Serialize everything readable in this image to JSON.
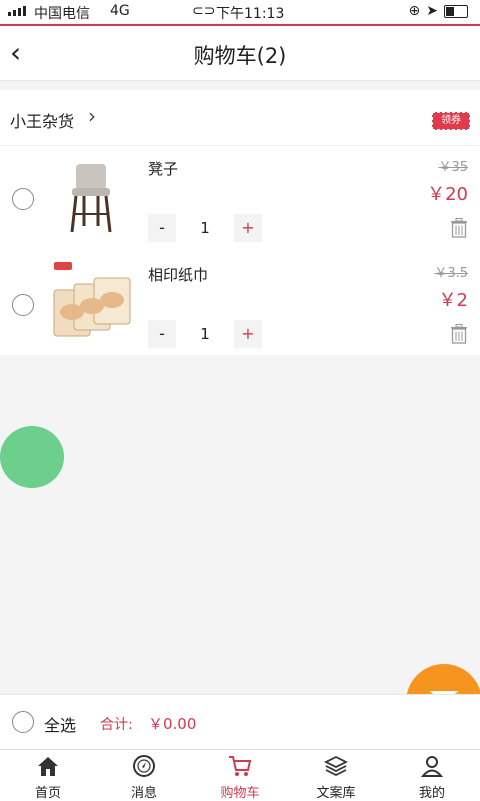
{
  "status_bar": {
    "carrier": "中国电信",
    "network": "4G",
    "time": "下午11:13"
  },
  "nav": {
    "title": "购物车(2)"
  },
  "shop": {
    "name": "小王杂货",
    "coupon_label": "领券"
  },
  "items": [
    {
      "name": "凳子",
      "original_price": "￥35",
      "price": "￥20",
      "quantity": "1",
      "minus": "-",
      "plus": "+"
    },
    {
      "name": "相印纸巾",
      "original_price": "￥3.5",
      "price": "￥2",
      "quantity": "1",
      "minus": "-",
      "plus": "+"
    }
  ],
  "footer": {
    "select_all": "全选",
    "total_label": "合计:",
    "total_value": "￥0.00"
  },
  "tabs": [
    {
      "label": "首页",
      "icon": "home-icon"
    },
    {
      "label": "消息",
      "icon": "compass-icon"
    },
    {
      "label": "购物车",
      "icon": "cart-icon",
      "active": true
    },
    {
      "label": "文案库",
      "icon": "layers-icon"
    },
    {
      "label": "我的",
      "icon": "user-icon"
    }
  ],
  "colors": {
    "accent": "#d23a52",
    "mail_button": "#f5941e",
    "float_button": "#6ccf8c"
  }
}
